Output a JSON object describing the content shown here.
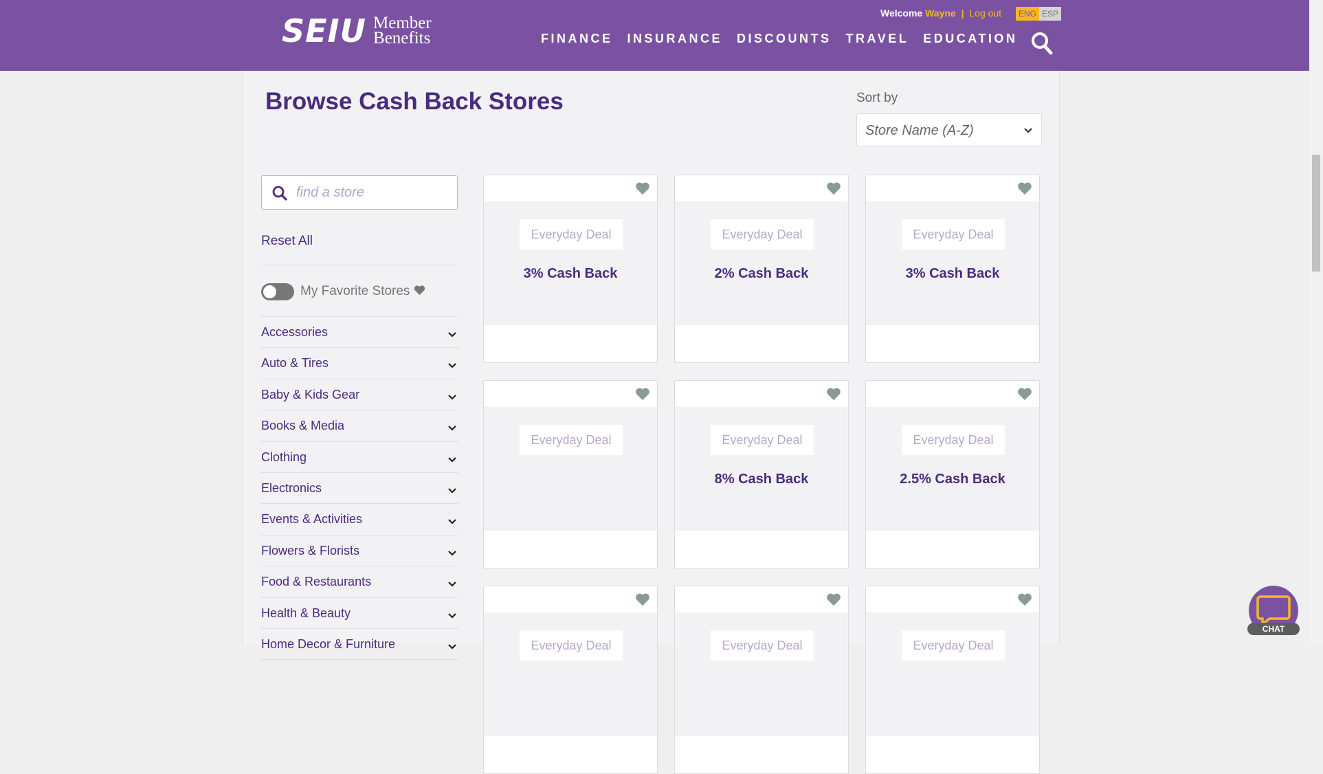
{
  "header": {
    "logo_seiu": "SEIU",
    "logo_line1": "Member",
    "logo_line2": "Benefits",
    "welcome_label": "Welcome",
    "user_name": "Wayne",
    "separator": "|",
    "logout": "Log out",
    "lang_eng": "ENG",
    "lang_esp": "ESP",
    "nav": [
      "FINANCE",
      "INSURANCE",
      "DISCOUNTS",
      "TRAVEL",
      "EDUCATION"
    ],
    "brand_color": "#7b52a1",
    "accent_color": "#f5b724"
  },
  "page": {
    "title": "Browse Cash Back Stores",
    "sort_label": "Sort by",
    "sort_value": "Store Name (A-Z)"
  },
  "sidebar": {
    "search_placeholder": "find a store",
    "reset": "Reset All",
    "favorites_label": "My Favorite Stores",
    "favorites_on": false,
    "categories": [
      "Accessories",
      "Auto & Tires",
      "Baby & Kids Gear",
      "Books & Media",
      "Clothing",
      "Electronics",
      "Events & Activities",
      "Flowers & Florists",
      "Food & Restaurants",
      "Health & Beauty",
      "Home Decor & Furniture"
    ]
  },
  "cards": [
    {
      "badge": "Everyday Deal",
      "cash": "3% Cash Back"
    },
    {
      "badge": "Everyday Deal",
      "cash": "2% Cash Back"
    },
    {
      "badge": "Everyday Deal",
      "cash": "3% Cash Back"
    },
    {
      "badge": "Everyday Deal",
      "cash": ""
    },
    {
      "badge": "Everyday Deal",
      "cash": "8% Cash Back"
    },
    {
      "badge": "Everyday Deal",
      "cash": "2.5% Cash Back"
    },
    {
      "badge": "Everyday Deal",
      "cash": ""
    },
    {
      "badge": "Everyday Deal",
      "cash": ""
    },
    {
      "badge": "Everyday Deal",
      "cash": ""
    }
  ],
  "chat": {
    "label": "CHAT"
  }
}
